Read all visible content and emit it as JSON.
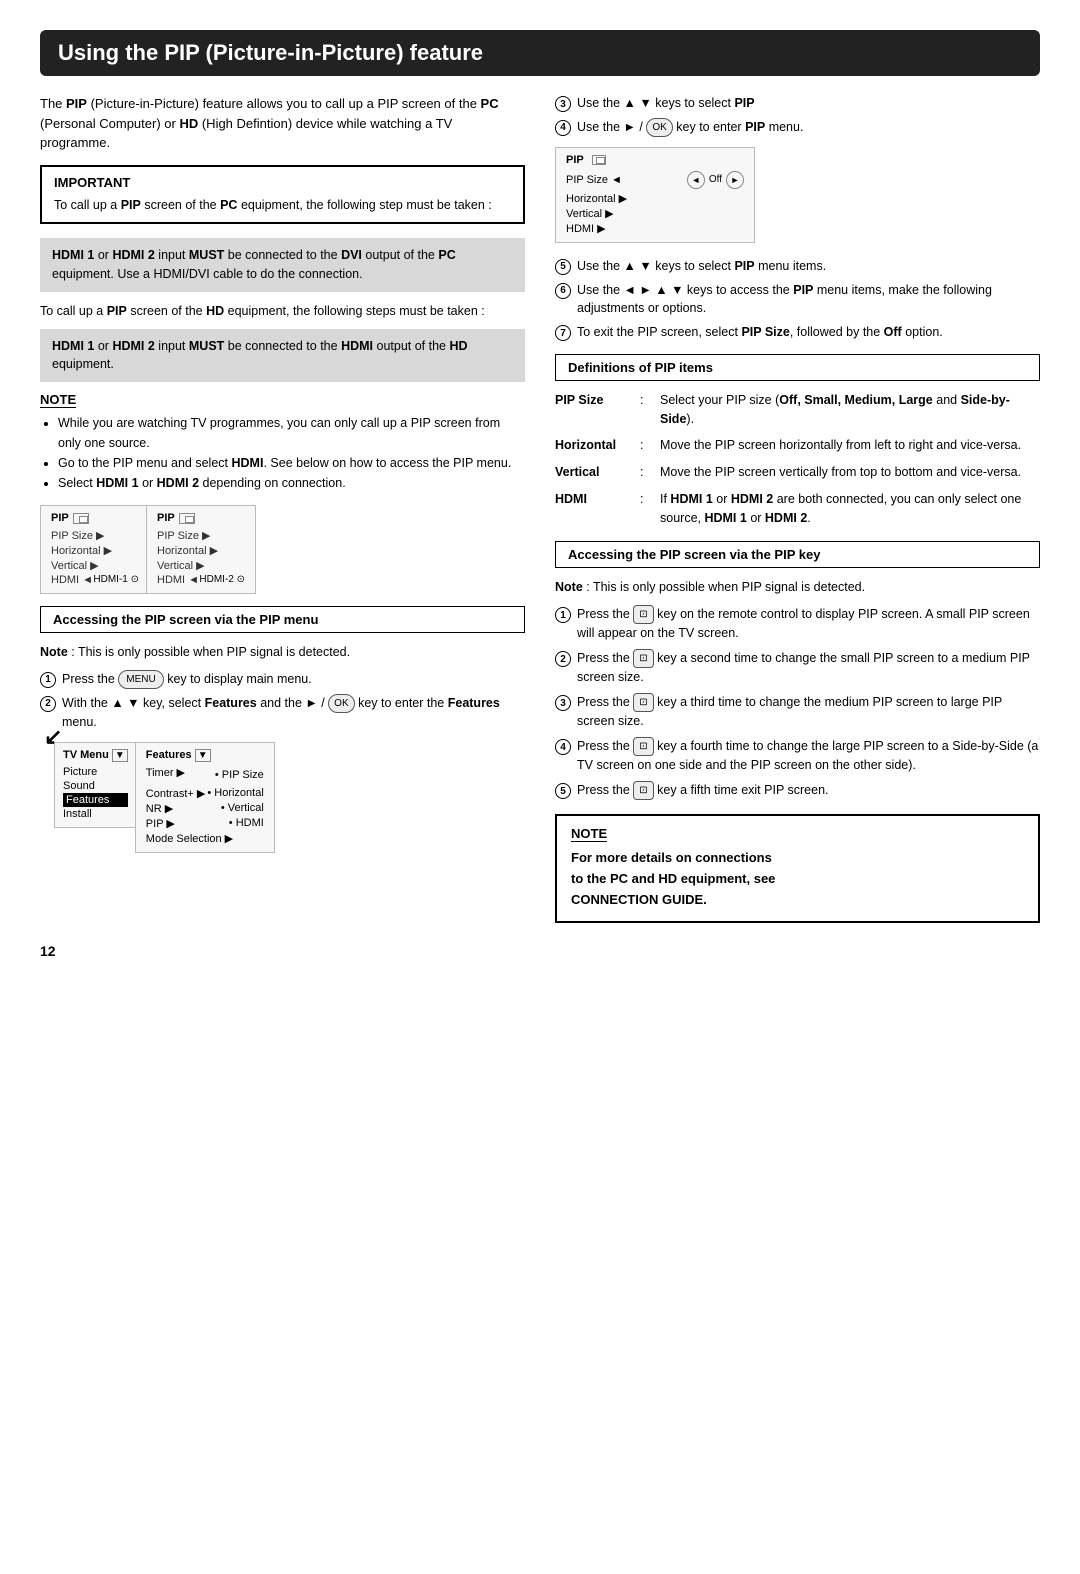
{
  "page": {
    "title": "Using the PIP (Picture-in-Picture) feature",
    "page_number": "12"
  },
  "left": {
    "intro": "The PIP (Picture-in-Picture) feature allows you to call up a PIP screen of the PC (Personal Computer) or HD (High Defintion) device while watching a TV programme.",
    "important": {
      "title": "IMPORTANT",
      "text": "To call up a PIP screen of the PC equipment, the following step must be taken :"
    },
    "gray_box_1": "HDMI 1 or HDMI 2 input MUST be connected to the DVI output of the PC equipment. Use a HDMI/DVI cable to do the connection.",
    "gray_box_2_prefix": "To call up a PIP screen of the HD equipment, the following steps must be taken :",
    "gray_box_3": "HDMI 1 or HDMI 2 input MUST be connected to the HDMI output of the HD equipment.",
    "note": {
      "title": "NOTE",
      "items": [
        "While you are watching TV programmes, you can only call up a PIP screen from only one source.",
        "Go to the PIP menu and select HDMI. See below on how to access the PIP menu.",
        "Select HDMI 1 or HDMI 2 depending on connection."
      ]
    },
    "pip_section_title": "Accessing the PIP screen via the PIP menu",
    "pip_note": "Note : This is only possible when PIP signal is detected.",
    "pip_steps": [
      "Press the MENU key to display main menu.",
      "With the ▲ ▼ key, select Features and the ► / OK key to enter the Features menu.",
      "Use the ▲ ▼ keys to select PIP",
      "Use the ► / OK key to enter PIP menu.",
      "Use the ▲ ▼ keys to select PIP menu items.",
      "Use the ◄ ► ▲ ▼ keys to access the PIP menu items, make the following adjustments or options.",
      "To exit the PIP screen, select PIP Size, followed by the Off option."
    ]
  },
  "right": {
    "definitions_title": "Definitions of PIP items",
    "definitions": [
      {
        "term": "PIP Size",
        "colon": ":",
        "desc": "Select your PIP size (Off, Small, Medium, Large and Side-by-Side)."
      },
      {
        "term": "Horizontal",
        "colon": ":",
        "desc": "Move the PIP screen horizontally from left to right and vice-versa."
      },
      {
        "term": "Vertical",
        "colon": ":",
        "desc": "Move the PIP screen vertically from top to bottom and vice-versa."
      },
      {
        "term": "HDMI",
        "colon": ":",
        "desc": "If HDMI 1 or HDMI 2 are both connected, you can only select one source, HDMI 1 or HDMI 2."
      }
    ],
    "pip_key_title": "Accessing the PIP screen via the PIP key",
    "pip_key_note": "Note : This is only possible when PIP signal is detected.",
    "pip_key_steps": [
      "Press the PIP key on the remote control to display PIP screen. A small PIP screen will appear on the TV screen.",
      "Press the PIP key a second time to change the small PIP screen to a medium PIP screen size.",
      "Press the PIP key a third time to change the medium PIP screen to large PIP screen size.",
      "Press the PIP key a fourth time to change the large PIP screen to a Side-by-Side (a TV screen on one side and the PIP screen on the other side).",
      "Press the PIP key a fifth time exit PIP screen."
    ],
    "note_bottom": {
      "title": "NOTE",
      "text": "For more details on connections to the PC and HD equipment, see CONNECTION GUIDE."
    }
  }
}
